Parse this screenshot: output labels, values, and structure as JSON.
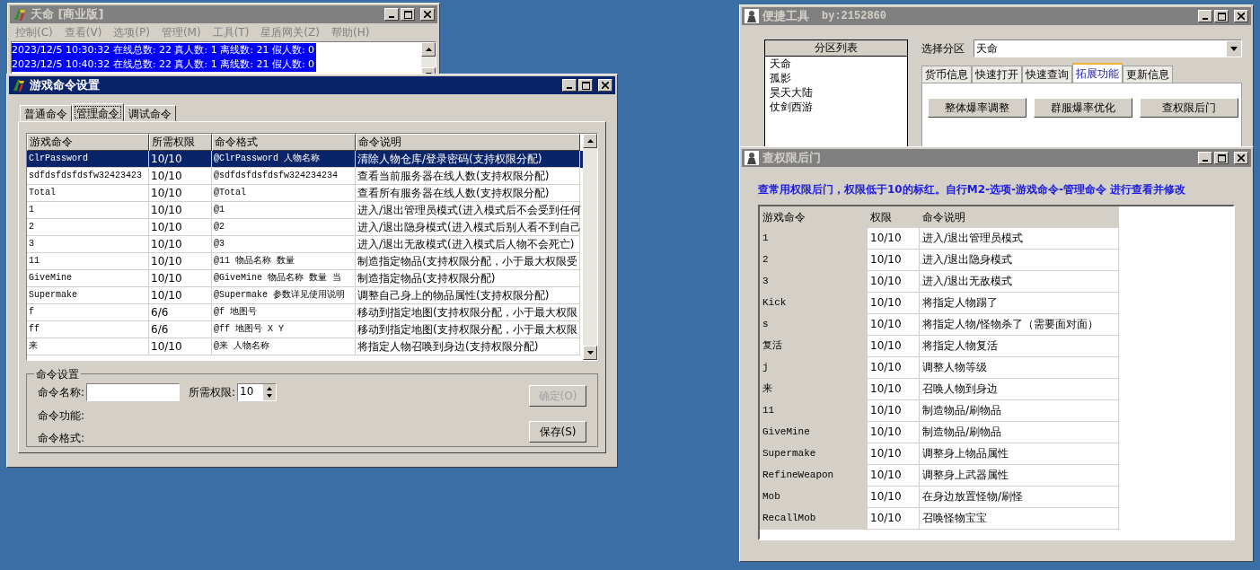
{
  "main_window": {
    "title": "天命 [商业版]",
    "menu": [
      "控制(C)",
      "查看(V)",
      "选项(P)",
      "管理(M)",
      "工具(T)",
      "星盾网关(Z)",
      "帮助(H)"
    ],
    "log_lines": [
      "2023/12/5 10:30:32 在线总数: 22 真人数: 1 离线数: 21 假人数: 0",
      "2023/12/5 10:40:32 在线总数: 22 真人数: 1 离线数: 21 假人数: 0"
    ]
  },
  "command_dialog": {
    "title": "游戏命令设置",
    "tabs": [
      {
        "label": "普通命令",
        "selected": false
      },
      {
        "label": "管理命令",
        "selected": true
      },
      {
        "label": "调试命令",
        "selected": false
      }
    ],
    "table": {
      "columns": [
        "游戏命令",
        "所需权限",
        "命令格式",
        "命令说明"
      ],
      "rows": [
        {
          "selected": true,
          "cells": [
            "ClrPassword",
            "10/10",
            "@ClrPassword 人物名称",
            "清除人物仓库/登录密码(支持权限分配)"
          ]
        },
        {
          "selected": false,
          "cells": [
            "sdfdsfdsfdsfw32423423",
            "10/10",
            "@sdfdsfdsfdsfw324234234",
            "查看当前服务器在线人数(支持权限分配)"
          ]
        },
        {
          "selected": false,
          "cells": [
            "Total",
            "10/10",
            "@Total",
            "查看所有服务器在线人数(支持权限分配)"
          ]
        },
        {
          "selected": false,
          "cells": [
            "1",
            "10/10",
            "@1",
            "进入/退出管理员模式(进入模式后不会受到任何"
          ]
        },
        {
          "selected": false,
          "cells": [
            "2",
            "10/10",
            "@2",
            "进入/退出隐身模式(进入模式后别人看不到自己"
          ]
        },
        {
          "selected": false,
          "cells": [
            "3",
            "10/10",
            "@3",
            "进入/退出无敌模式(进入模式后人物不会死亡)"
          ]
        },
        {
          "selected": false,
          "cells": [
            "11",
            "10/10",
            "@11 物品名称 数量",
            "制造指定物品(支持权限分配，小于最大权限受"
          ]
        },
        {
          "selected": false,
          "cells": [
            "GiveMine",
            "10/10",
            "@GiveMine 物品名称 数量 当",
            "制造指定物品(支持权限分配)"
          ]
        },
        {
          "selected": false,
          "cells": [
            "Supermake",
            "10/10",
            "@Supermake 参数详见使用说明",
            "调整自己身上的物品属性(支持权限分配)"
          ]
        },
        {
          "selected": false,
          "cells": [
            "f",
            "6/6",
            "@f 地图号",
            "移动到指定地图(支持权限分配，小于最大权限"
          ]
        },
        {
          "selected": false,
          "cells": [
            "ff",
            "6/6",
            "@ff 地图号 X Y",
            "移动到指定地图(支持权限分配，小于最大权限"
          ]
        },
        {
          "selected": false,
          "cells": [
            "来",
            "10/10",
            "@来 人物名称",
            "将指定人物召唤到身边(支持权限分配)"
          ]
        }
      ]
    },
    "settings": {
      "group_title": "命令设置",
      "name_label": "命令名称:",
      "permission_label": "所需权限:",
      "permission_value": "10",
      "function_label": "命令功能:",
      "format_label": "命令格式:",
      "buttons": [
        {
          "label": "确定(O)",
          "disabled": true
        },
        {
          "label": "保存(S)",
          "disabled": false
        }
      ]
    }
  },
  "quick_tools": {
    "title": "便捷工具",
    "subtitle": "by:2152860",
    "partition_list": {
      "header": "分区列表",
      "items": [
        "天命",
        "孤影",
        "昊天大陆",
        "仗剑西游"
      ]
    },
    "select_label": "选择分区",
    "select_value": "天命",
    "tabs": [
      {
        "label": "货币信息",
        "selected": false
      },
      {
        "label": "快速打开",
        "selected": false
      },
      {
        "label": "快速查询",
        "selected": false
      },
      {
        "label": "拓展功能",
        "selected": true
      },
      {
        "label": "更新信息",
        "selected": false
      }
    ],
    "buttons": [
      "整体爆率调整",
      "群服爆率优化",
      "查权限后门"
    ]
  },
  "backdoor_window": {
    "title": "查权限后门",
    "notice": "查常用权限后门，权限低于10的标红。自行M2-选项-游戏命令-管理命令 进行查看并修改",
    "columns": [
      "游戏命令",
      "权限",
      "命令说明"
    ],
    "rows": [
      [
        "1",
        "10/10",
        "进入/退出管理员模式"
      ],
      [
        "2",
        "10/10",
        "进入/退出隐身模式"
      ],
      [
        "3",
        "10/10",
        "进入/退出无敌模式"
      ],
      [
        "Kick",
        "10/10",
        "将指定人物踢了"
      ],
      [
        "s",
        "10/10",
        "将指定人物/怪物杀了（需要面对面）"
      ],
      [
        "复活",
        "10/10",
        "将指定人物复活"
      ],
      [
        "j",
        "10/10",
        "调整人物等级"
      ],
      [
        "来",
        "10/10",
        "召唤人物到身边"
      ],
      [
        "11",
        "10/10",
        "制造物品/刷物品"
      ],
      [
        "GiveMine",
        "10/10",
        "制造物品/刷物品"
      ],
      [
        "Supermake",
        "10/10",
        "调整身上物品属性"
      ],
      [
        "RefineWeapon",
        "10/10",
        "调整身上武器属性"
      ],
      [
        "Mob",
        "10/10",
        "在身边放置怪物/刷怪"
      ],
      [
        "RecallMob",
        "10/10",
        "召唤怪物宝宝"
      ]
    ]
  }
}
